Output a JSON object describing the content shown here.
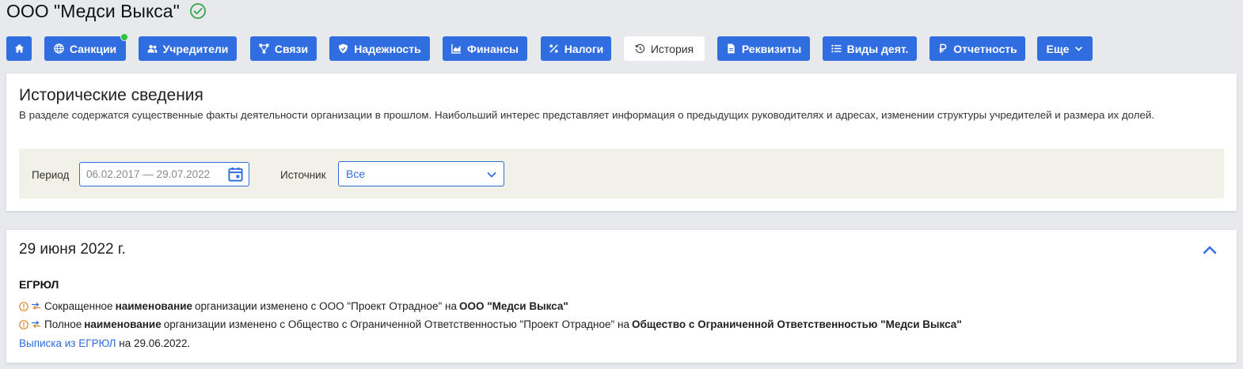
{
  "company": {
    "name": "ООО \"Медси Выкса\""
  },
  "tabs": [
    {
      "label": ""
    },
    {
      "label": "Санкции"
    },
    {
      "label": "Учредители"
    },
    {
      "label": "Связи"
    },
    {
      "label": "Надежность"
    },
    {
      "label": "Финансы"
    },
    {
      "label": "Налоги"
    },
    {
      "label": "История"
    },
    {
      "label": "Реквизиты"
    },
    {
      "label": "Виды деят."
    },
    {
      "label": "Отчетность"
    },
    {
      "label": "Еще"
    }
  ],
  "history": {
    "heading": "Исторические сведения",
    "description": "В разделе содержатся существенные факты деятельности организации в прошлом. Наибольший интерес представляет информация о предыдущих руководителях и адресах, изменении структуры учредителей и размера их долей.",
    "filters": {
      "period_label": "Период",
      "period_value": "06.02.2017 — 29.07.2022",
      "source_label": "Источник",
      "source_value": "Все"
    }
  },
  "event": {
    "date": "29 июня 2022 г.",
    "source": "ЕГРЮЛ",
    "changes": [
      {
        "prefix": "Сокращенное",
        "field": "наименование",
        "middle": "организации изменено с ООО \"Проект Отрадное\" на",
        "new_value": "ООО \"Медси Выкса\""
      },
      {
        "prefix": "Полное",
        "field": "наименование",
        "middle": "организации изменено с Общество с Ограниченной Ответственностью \"Проект Отрадное\" на",
        "new_value": "Общество с Ограниченной Ответственностью \"Медси Выкса\""
      }
    ],
    "extract_link": "Выписка из ЕГРЮЛ",
    "extract_suffix": "на 29.06.2022."
  },
  "colors": {
    "accent": "#2f6de1",
    "verified": "#3aa54a",
    "warning": "#e0862a",
    "indicator": "#2fc23a"
  }
}
